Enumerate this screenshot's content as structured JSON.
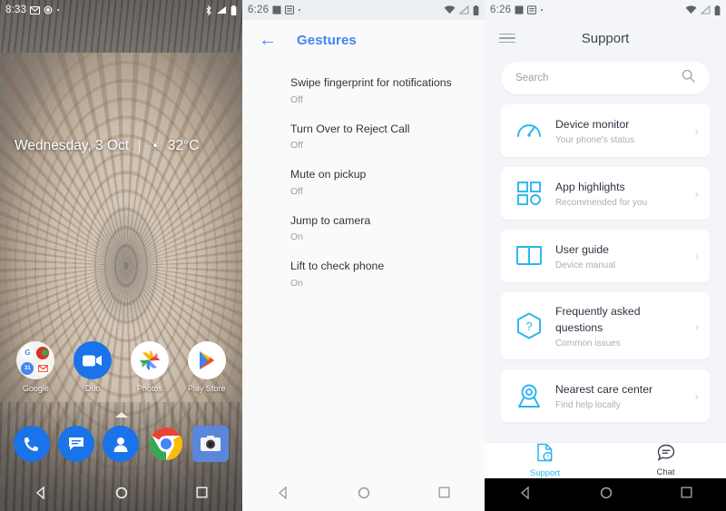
{
  "panels": {
    "home": {
      "name": "android-home-screen",
      "statusbar": {
        "time": "8:33",
        "left_icons": [
          "gmail-icon",
          "app-notification-icon",
          "more-dot-icon"
        ],
        "right_icons": [
          "bluetooth-icon",
          "signal-icon",
          "battery-icon"
        ]
      },
      "widget": {
        "date": "Wednesday, 3 Oct",
        "weather_icon": "sun-icon",
        "temperature": "32°C"
      },
      "apps": [
        {
          "label": "Google",
          "icon": "google-folder-icon"
        },
        {
          "label": "Duo",
          "icon": "duo-icon"
        },
        {
          "label": "Photos",
          "icon": "photos-icon"
        },
        {
          "label": "Play Store",
          "icon": "play-store-icon"
        }
      ],
      "dock": [
        {
          "label": "Phone",
          "icon": "phone-icon"
        },
        {
          "label": "Messages",
          "icon": "messages-icon"
        },
        {
          "label": "Contacts",
          "icon": "contacts-icon"
        },
        {
          "label": "Chrome",
          "icon": "chrome-icon"
        },
        {
          "label": "Camera",
          "icon": "camera-icon"
        }
      ],
      "drawer_handle": "app-drawer-chevron-up",
      "navbar": {
        "back": "back-icon",
        "home": "home-icon",
        "recents": "recents-icon"
      }
    },
    "gestures": {
      "name": "gestures-settings",
      "statusbar": {
        "time": "6:26",
        "left_icons": [
          "screenshot-icon",
          "sim-icon",
          "more-dot-icon"
        ],
        "right_icons": [
          "wifi-icon",
          "signal-off-icon",
          "battery-icon"
        ]
      },
      "appbar": {
        "back_icon": "back-arrow-icon",
        "title": "Gestures",
        "accent": "#4285f4"
      },
      "items": [
        {
          "title": "Swipe fingerprint for notifications",
          "value": "Off"
        },
        {
          "title": "Turn Over to Reject Call",
          "value": "Off"
        },
        {
          "title": "Mute on pickup",
          "value": "Off"
        },
        {
          "title": "Jump to camera",
          "value": "On"
        },
        {
          "title": "Lift to check phone",
          "value": "On"
        }
      ],
      "navbar": {
        "back": "back-icon",
        "home": "home-icon",
        "recents": "recents-icon"
      }
    },
    "support": {
      "name": "support-app",
      "statusbar": {
        "time": "6:26",
        "left_icons": [
          "screenshot-icon",
          "sim-icon",
          "more-dot-icon"
        ],
        "right_icons": [
          "wifi-icon",
          "signal-off-icon",
          "battery-icon"
        ]
      },
      "appbar": {
        "menu_icon": "hamburger-menu-icon",
        "title": "Support"
      },
      "search": {
        "placeholder": "Search",
        "value": "",
        "icon": "search-icon"
      },
      "cards": [
        {
          "title": "Device monitor",
          "subtitle": "Your phone's status",
          "icon": "gauge-icon"
        },
        {
          "title": "App highlights",
          "subtitle": "Recommended for you",
          "icon": "app-grid-icon"
        },
        {
          "title": "User guide",
          "subtitle": "Device manual",
          "icon": "book-icon"
        },
        {
          "title": "Frequently asked questions",
          "subtitle": "Common issues",
          "icon": "hexagon-question-icon"
        },
        {
          "title": "Nearest care center",
          "subtitle": "Find help locally",
          "icon": "map-pin-icon"
        }
      ],
      "tabs": [
        {
          "label": "Support",
          "icon": "support-doc-icon",
          "active": true
        },
        {
          "label": "Chat",
          "icon": "chat-bubble-icon",
          "active": false
        }
      ],
      "accent": "#2ab8ef",
      "navbar": {
        "back": "back-icon",
        "home": "home-icon",
        "recents": "recents-icon"
      }
    }
  }
}
